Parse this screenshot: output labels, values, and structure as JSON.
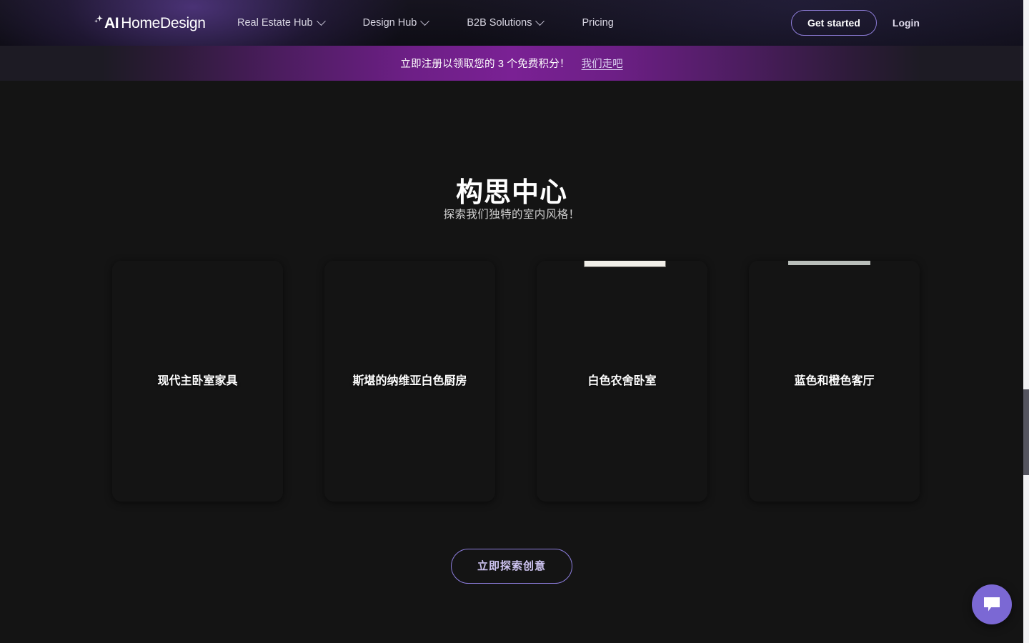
{
  "header": {
    "logo": {
      "prefix": "AI",
      "suffix": "HomeDesign",
      "icon": "sparkle-icon"
    },
    "nav": [
      {
        "label": "Real Estate Hub",
        "has_dropdown": true
      },
      {
        "label": "Design Hub",
        "has_dropdown": true
      },
      {
        "label": "B2B Solutions",
        "has_dropdown": true
      },
      {
        "label": "Pricing",
        "has_dropdown": false
      }
    ],
    "get_started_label": "Get started",
    "login_label": "Login"
  },
  "banner": {
    "text": "立即注册以领取您的 3 个免费积分！",
    "link_label": "我们走吧"
  },
  "main": {
    "title": "构思中心",
    "subtitle": "探索我们独特的室内风格！",
    "cards": [
      {
        "label": "现代主卧室家具",
        "style_class": "img-bedroom-modern"
      },
      {
        "label": "斯堪的纳维亚白色厨房",
        "style_class": "img-kitchen"
      },
      {
        "label": "白色农舍卧室",
        "style_class": "img-farmhouse"
      },
      {
        "label": "蓝色和橙色客厅",
        "style_class": "img-livingroom"
      }
    ],
    "cta_label": "立即探索创意"
  },
  "chat": {
    "icon": "chat-bubble-icon"
  },
  "colors": {
    "page_background": "#141414",
    "header_background": "#0e0d15",
    "banner_accent": "#7a2194",
    "accent_purple": "#8d7ede",
    "chat_button": "#7b68d4",
    "text_primary": "#ffffff",
    "text_secondary": "#cfcfcf"
  }
}
